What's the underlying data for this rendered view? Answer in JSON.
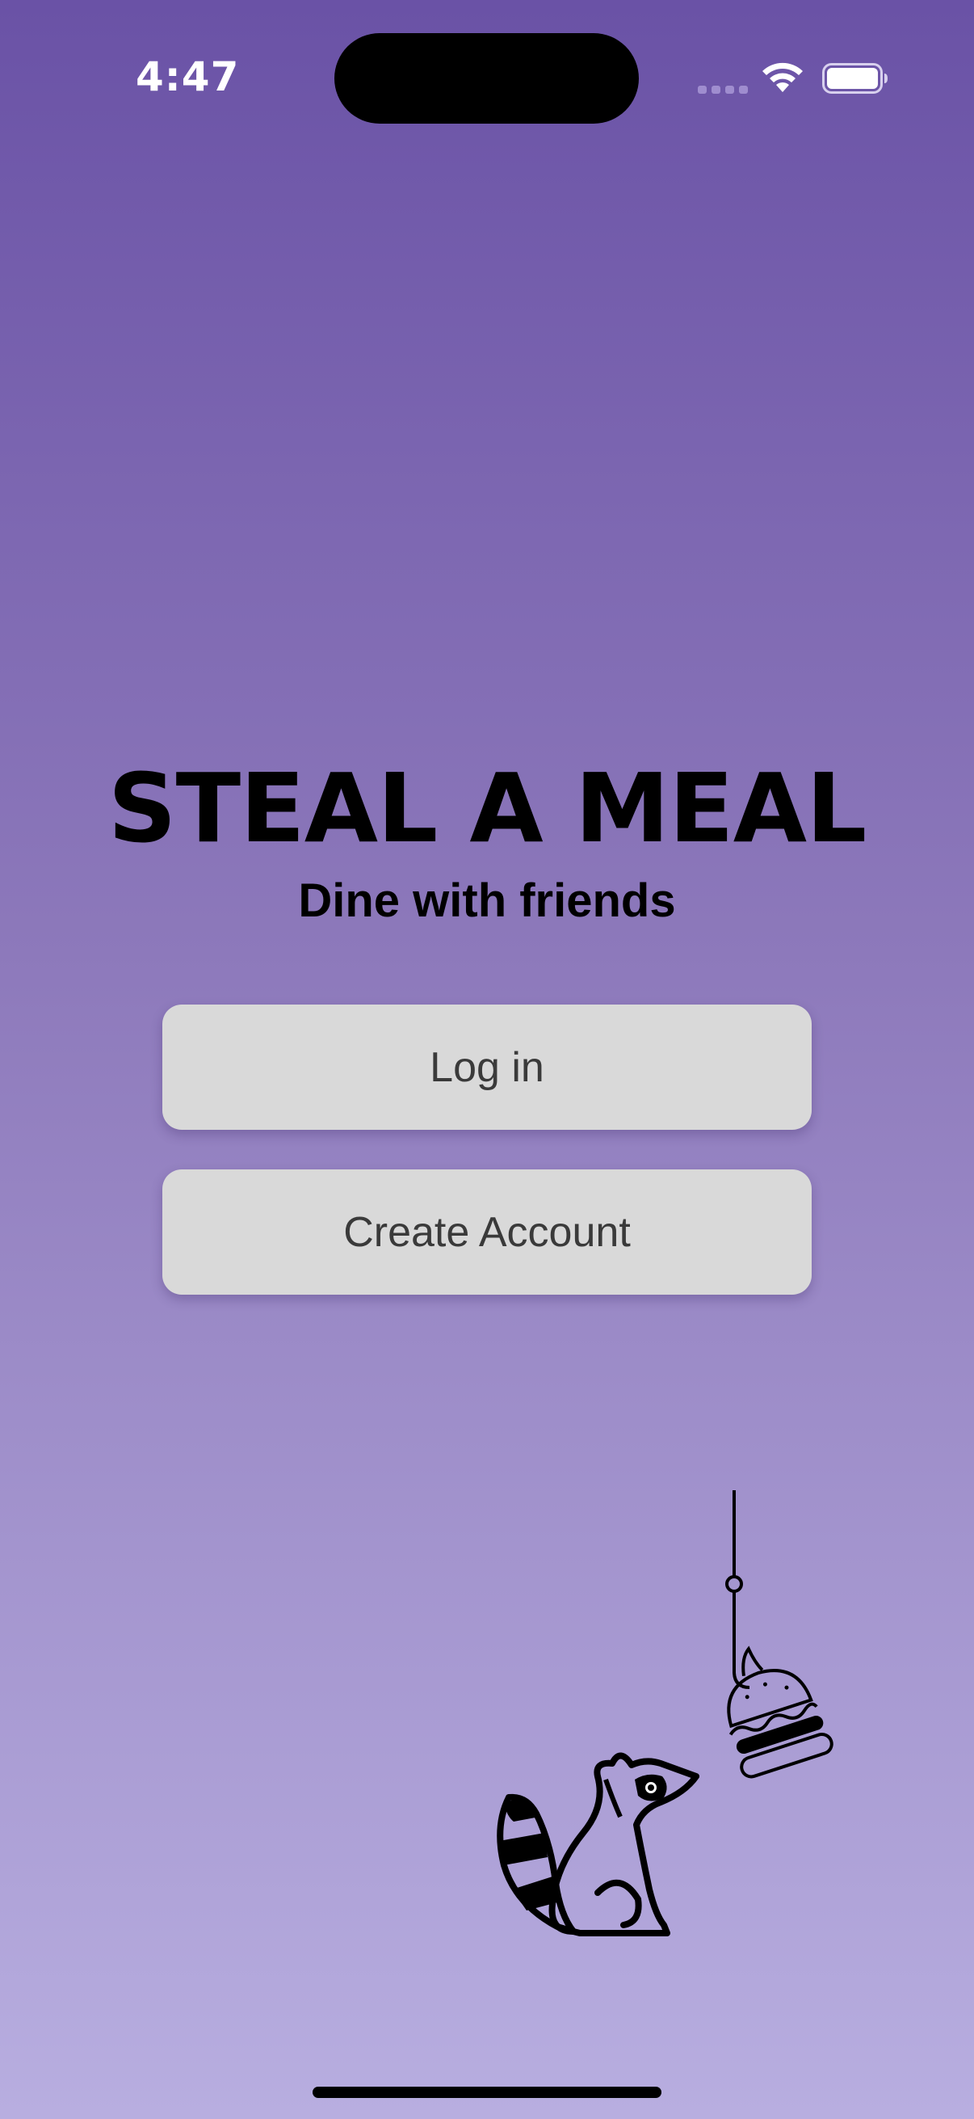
{
  "status_bar": {
    "time": "4:47",
    "icons": [
      "signal-icon",
      "wifi-icon",
      "battery-icon"
    ]
  },
  "app": {
    "title": "STEAL A MEAL",
    "subtitle": "Dine with friends"
  },
  "actions": {
    "login_label": "Log in",
    "create_account_label": "Create Account"
  },
  "illustration": {
    "icons": [
      "raccoon-icon",
      "fishing-hook-icon",
      "burger-icon"
    ]
  },
  "colors": {
    "gradient_top": "#6a52a6",
    "gradient_bottom": "#b8aee0",
    "button_bg": "#d9d9d9",
    "button_text": "#3a3a3a"
  }
}
